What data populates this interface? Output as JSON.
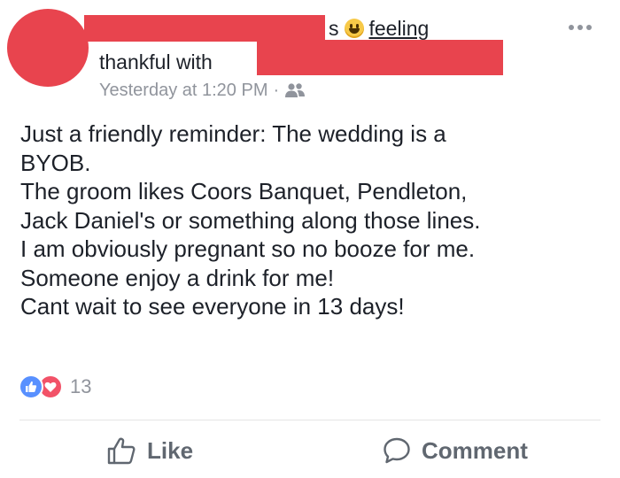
{
  "post": {
    "header": {
      "line1_suffix": "s",
      "feeling_label": "feeling",
      "line2_text": "thankful with",
      "timestamp": "Yesterday at 1:20 PM",
      "separator": "·",
      "audience_icon": "friends-icon"
    },
    "body_lines": [
      "Just a friendly reminder: The wedding is a",
      "BYOB.",
      "The groom likes Coors Banquet, Pendleton,",
      "Jack Daniel's or something along those lines.",
      "I am obviously pregnant so no booze for me.",
      "Someone enjoy a drink for me!",
      "Cant wait to see everyone in 13 days!"
    ],
    "reactions": {
      "count": "13",
      "types": [
        "like",
        "love"
      ]
    },
    "actions": {
      "like_label": "Like",
      "comment_label": "Comment"
    }
  },
  "colors": {
    "redaction": "#e8444e",
    "text": "#1d2129",
    "meta": "#90949c",
    "like_blue": "#5890ff",
    "love_red": "#f25268",
    "action_gray": "#606770"
  }
}
